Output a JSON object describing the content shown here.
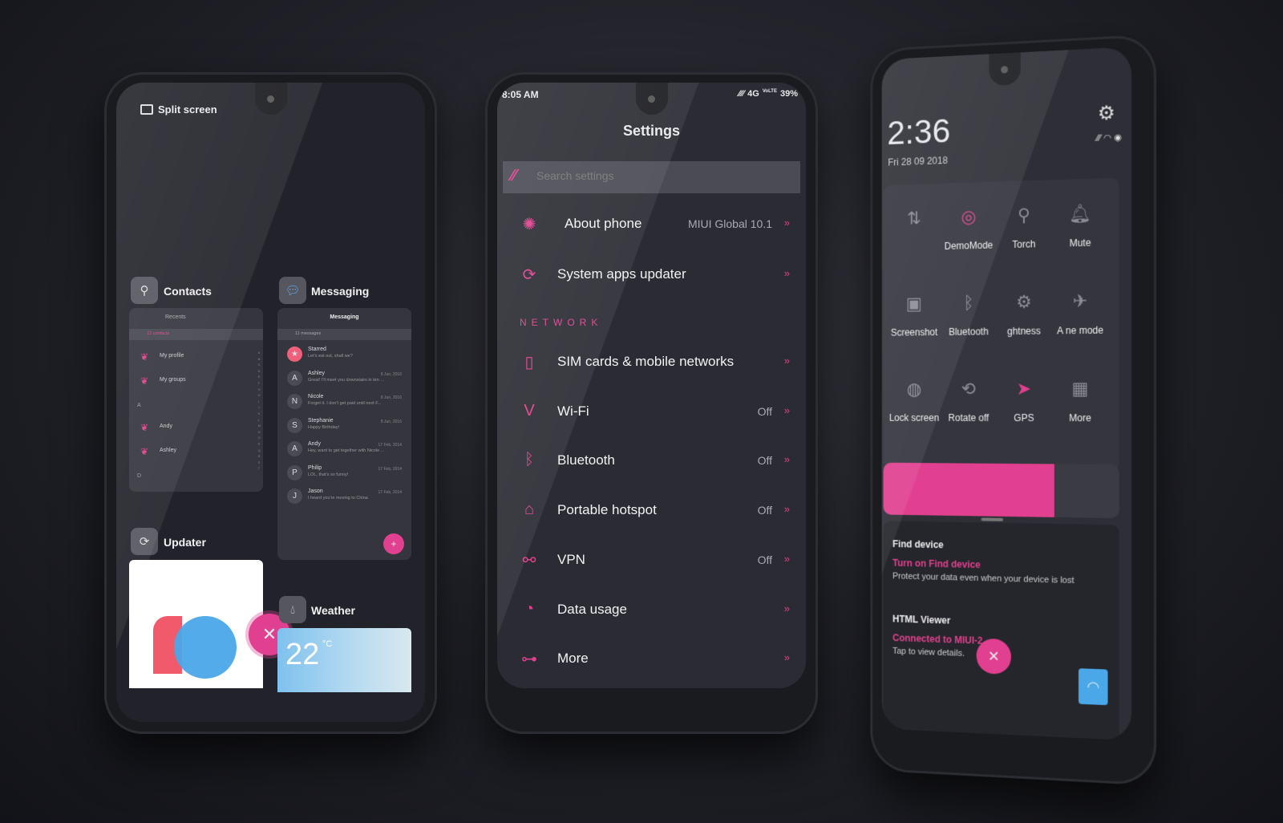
{
  "colors": {
    "accent": "#e0408f",
    "background": "#2b2c33",
    "wifi_tile": "#4aa8e8"
  },
  "left_phone": {
    "header": {
      "icon": "split-screen-icon",
      "label": "Split screen"
    },
    "contacts": {
      "title": "Contacts",
      "icon": "contacts-icon",
      "card_title": "Recents",
      "count": "12 contacts",
      "items": [
        {
          "label": "My profile"
        },
        {
          "label": "My groups"
        },
        {
          "section": "A"
        },
        {
          "label": "Andy"
        },
        {
          "label": "Ashley"
        },
        {
          "section": "D"
        }
      ],
      "index": [
        "A",
        "B",
        "C",
        "D",
        "E",
        "F",
        "G",
        "H",
        "I",
        "J",
        "K",
        "L",
        "M",
        "N",
        "O",
        "P",
        "Q",
        "R",
        "S",
        "T"
      ]
    },
    "messaging": {
      "title": "Messaging",
      "icon": "messaging-icon",
      "card_title": "Messaging",
      "count": "11 messages",
      "items": [
        {
          "avatar": "★",
          "name": "Starred",
          "preview": "Let's eat out, shall we?",
          "date": ""
        },
        {
          "avatar": "A",
          "name": "Ashley",
          "preview": "Great! I'll meet you downstairs in ten ...",
          "date": "8 Jun, 2016"
        },
        {
          "avatar": "N",
          "name": "Nicole",
          "preview": "Forget it. I don't get paid until next F...",
          "date": "8 Jun, 2016"
        },
        {
          "avatar": "S",
          "name": "Stephanie",
          "preview": "Happy Birthday!",
          "date": "8 Jun, 2016"
        },
        {
          "avatar": "A",
          "name": "Andy",
          "preview": "Hey, want to get together with Nicole ...",
          "date": "17 Feb, 2014"
        },
        {
          "avatar": "P",
          "name": "Philip",
          "preview": "LOL, that's so funny!",
          "date": "17 Feb, 2014"
        },
        {
          "avatar": "J",
          "name": "Jason",
          "preview": "I heard you're moving to China",
          "date": "17 Feb, 2014"
        }
      ]
    },
    "updater": {
      "title": "Updater",
      "icon": "updater-icon",
      "logo_text": "10"
    },
    "weather": {
      "title": "Weather",
      "icon": "weather-icon",
      "temp": "22",
      "unit": "°C"
    }
  },
  "middle_phone": {
    "status": {
      "time": "8:05 AM",
      "network": "4G",
      "volte": "VoLTE",
      "battery": "39%"
    },
    "title": "Settings",
    "search_placeholder": "Search settings",
    "top_rows": [
      {
        "icon": "about-phone-icon",
        "glyph": "✺",
        "label": "About phone",
        "value": "MIUI Global 10.1"
      },
      {
        "icon": "system-apps-updater-icon",
        "glyph": "⟳",
        "label": "System apps updater",
        "value": ""
      }
    ],
    "section": "NETWORK",
    "network_rows": [
      {
        "icon": "sim-card-icon",
        "glyph": "▯",
        "label": "SIM cards & mobile networks",
        "value": ""
      },
      {
        "icon": "wifi-icon",
        "glyph": "V",
        "label": "Wi-Fi",
        "value": "Off"
      },
      {
        "icon": "bluetooth-icon",
        "glyph": "ᛒ",
        "label": "Bluetooth",
        "value": "Off"
      },
      {
        "icon": "hotspot-icon",
        "glyph": "⌂",
        "label": "Portable hotspot",
        "value": "Off"
      },
      {
        "icon": "vpn-icon",
        "glyph": "⚯",
        "label": "VPN",
        "value": "Off"
      },
      {
        "icon": "data-usage-icon",
        "glyph": "◔",
        "label": "Data usage",
        "value": ""
      },
      {
        "icon": "more-icon",
        "glyph": "⊶",
        "label": "More",
        "value": ""
      }
    ],
    "chevron": "»"
  },
  "right_phone": {
    "clock": "2:36",
    "date": "Fri 28 09 2018",
    "tiles": [
      {
        "icon": "mobile-data-icon",
        "glyph": "⇅",
        "label": "",
        "active": false
      },
      {
        "icon": "demo-mode-icon",
        "glyph": "◎",
        "label": "DemoMode",
        "active": true
      },
      {
        "icon": "torch-icon",
        "glyph": "⚲",
        "label": "Torch",
        "active": false
      },
      {
        "icon": "mute-icon",
        "glyph": "🔔︎",
        "label": "Mute",
        "active": false
      },
      {
        "icon": "screenshot-icon",
        "glyph": "▣",
        "label": "Screenshot",
        "active": false
      },
      {
        "icon": "bluetooth-icon",
        "glyph": "ᛒ",
        "label": "Bluetooth",
        "active": false
      },
      {
        "icon": "brightness-icon",
        "glyph": "⚙",
        "label": "ghtness",
        "active": false
      },
      {
        "icon": "airplane-icon",
        "glyph": "✈",
        "label": "A ne mode",
        "active": false
      },
      {
        "icon": "lock-screen-icon",
        "glyph": "◍",
        "label": "Lock screen",
        "active": false
      },
      {
        "icon": "rotate-icon",
        "glyph": "⟲",
        "label": "Rotate off",
        "active": false
      },
      {
        "icon": "gps-icon",
        "glyph": "➤",
        "label": "GPS",
        "active": true
      },
      {
        "icon": "more-grid-icon",
        "glyph": "▦",
        "label": "More",
        "active": false
      }
    ],
    "brightness_percent": 73,
    "notifications": [
      {
        "icon": "find-device-icon",
        "app": "Find device",
        "title": "Turn on Find device",
        "body": "Protect your data even when your device is lost"
      },
      {
        "icon": "html-viewer-icon",
        "app": "HTML Viewer",
        "title": "Connected to MIUI-2",
        "body": "Tap to view details."
      }
    ]
  }
}
